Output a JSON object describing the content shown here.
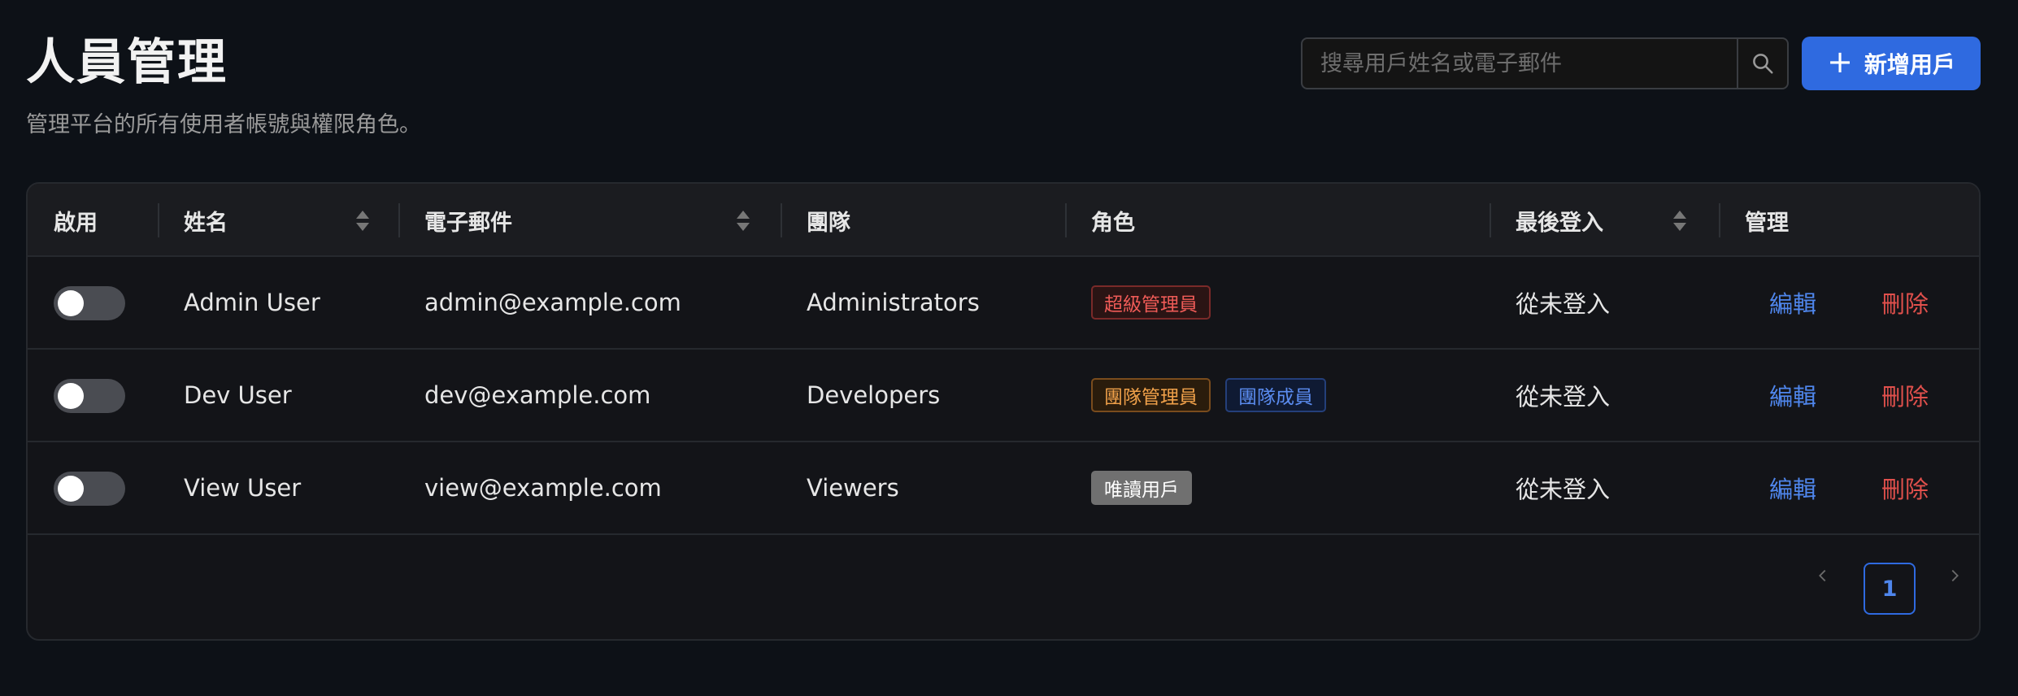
{
  "header": {
    "title": "人員管理",
    "subtitle": "管理平台的所有使用者帳號與權限角色。",
    "search_placeholder": "搜尋用戶姓名或電子郵件",
    "add_button_label": "新增用戶"
  },
  "table": {
    "columns": {
      "enabled": "啟用",
      "name": "姓名",
      "email": "電子郵件",
      "team": "團隊",
      "role": "角色",
      "last_login": "最後登入",
      "manage": "管理"
    },
    "rows": [
      {
        "enabled": false,
        "name": "Admin User",
        "email": "admin@example.com",
        "team": "Administrators",
        "roles": [
          {
            "label": "超級管理員",
            "color": "red"
          }
        ],
        "last_login": "從未登入",
        "edit_label": "編輯",
        "delete_label": "刪除"
      },
      {
        "enabled": false,
        "name": "Dev User",
        "email": "dev@example.com",
        "team": "Developers",
        "roles": [
          {
            "label": "團隊管理員",
            "color": "orange"
          },
          {
            "label": "團隊成員",
            "color": "blue"
          }
        ],
        "last_login": "從未登入",
        "edit_label": "編輯",
        "delete_label": "刪除"
      },
      {
        "enabled": false,
        "name": "View User",
        "email": "view@example.com",
        "team": "Viewers",
        "roles": [
          {
            "label": "唯讀用戶",
            "color": "gray"
          }
        ],
        "last_login": "從未登入",
        "edit_label": "編輯",
        "delete_label": "刪除"
      }
    ]
  },
  "pagination": {
    "current_page": "1",
    "prev_icon": "chevron-left-icon",
    "next_icon": "chevron-right-icon"
  },
  "colors": {
    "background": "#0d1117",
    "accent": "#2f6ae0",
    "danger": "#e0504c"
  }
}
